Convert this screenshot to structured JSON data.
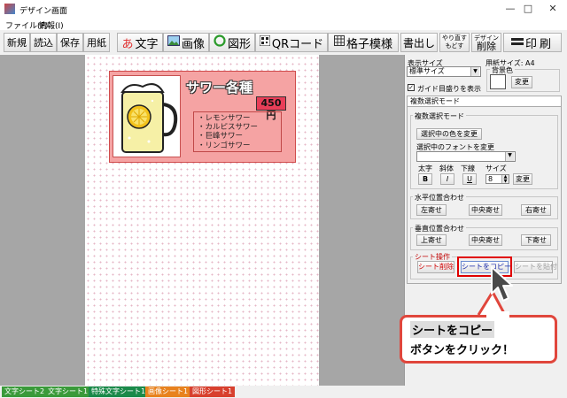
{
  "window": {
    "title": "デザイン画面",
    "minimize": "—",
    "maximize": "□",
    "close": "✕"
  },
  "menu": [
    "ファイル(F)",
    "情報(I)"
  ],
  "toolbar": {
    "new": "新規",
    "open": "読込",
    "save": "保存",
    "paper": "用紙",
    "text": "文字",
    "text_glyph": "あ",
    "image": "画像",
    "shape": "図形",
    "qr": "QRコード",
    "grid": "格子模様",
    "write": "書出し",
    "redo_top": "やり直す",
    "redo_bottom": "もどす",
    "design": "デザイン",
    "delete": "削除",
    "print": "印刷"
  },
  "card": {
    "title": "サワー各種",
    "price": "450円",
    "items": [
      "・レモンサワー",
      "・カルピスサワー",
      "・巨峰サワー",
      "・リンゴサワー"
    ]
  },
  "panel": {
    "display_size_label": "表示サイズ",
    "display_size_value": "標準サイズ",
    "paper_size_label": "用紙サイズ: A4",
    "bg_color_label": "背景色",
    "change": "変更",
    "guide_label": "ガイド目盛りを表示",
    "guide_checked": true,
    "tab": "複数選択モード",
    "group_title": "複数選択モード",
    "change_color": "選択中の色を変更",
    "change_font": "選択中のフォントを変更",
    "bold_label": "太字",
    "italic_label": "斜体",
    "underline_label": "下線",
    "size_label": "サイズ",
    "bold": "B",
    "italic": "I",
    "underline": "U",
    "size_value": "8",
    "halign_title": "水平位置合わせ",
    "halign": [
      "左寄せ",
      "中央寄せ",
      "右寄せ"
    ],
    "valign_title": "垂直位置合わせ",
    "valign": [
      "上寄せ",
      "中央寄せ",
      "下寄せ"
    ],
    "sheet_ops_title": "シート操作",
    "sheet_delete": "シート削除",
    "sheet_copy": "シートをコピー",
    "sheet_paste": "シートを貼付"
  },
  "status_tabs": [
    {
      "label": "文字シート2",
      "color": "#3a9a3a"
    },
    {
      "label": "文字シート1",
      "color": "#3a9a3a"
    },
    {
      "label": "特殊文字シート1",
      "color": "#1a8a4a"
    },
    {
      "label": "画像シート1",
      "color": "#e8821e"
    },
    {
      "label": "図形シート1",
      "color": "#d8402e"
    }
  ],
  "callout": {
    "line1": "シートをコピー",
    "line2": "ボタンをクリック！"
  },
  "colors": {
    "accent_red": "#e0463c",
    "card_fill": "#f5a3a3",
    "price_fill": "#e93e58",
    "highlight": "#e00000"
  },
  "icons": [
    "app-icon",
    "image-icon",
    "shape-circle-icon",
    "qr-icon",
    "grid-icon",
    "print-icon",
    "mouse-cursor-icon",
    "lemon-sour-glass-icon"
  ]
}
